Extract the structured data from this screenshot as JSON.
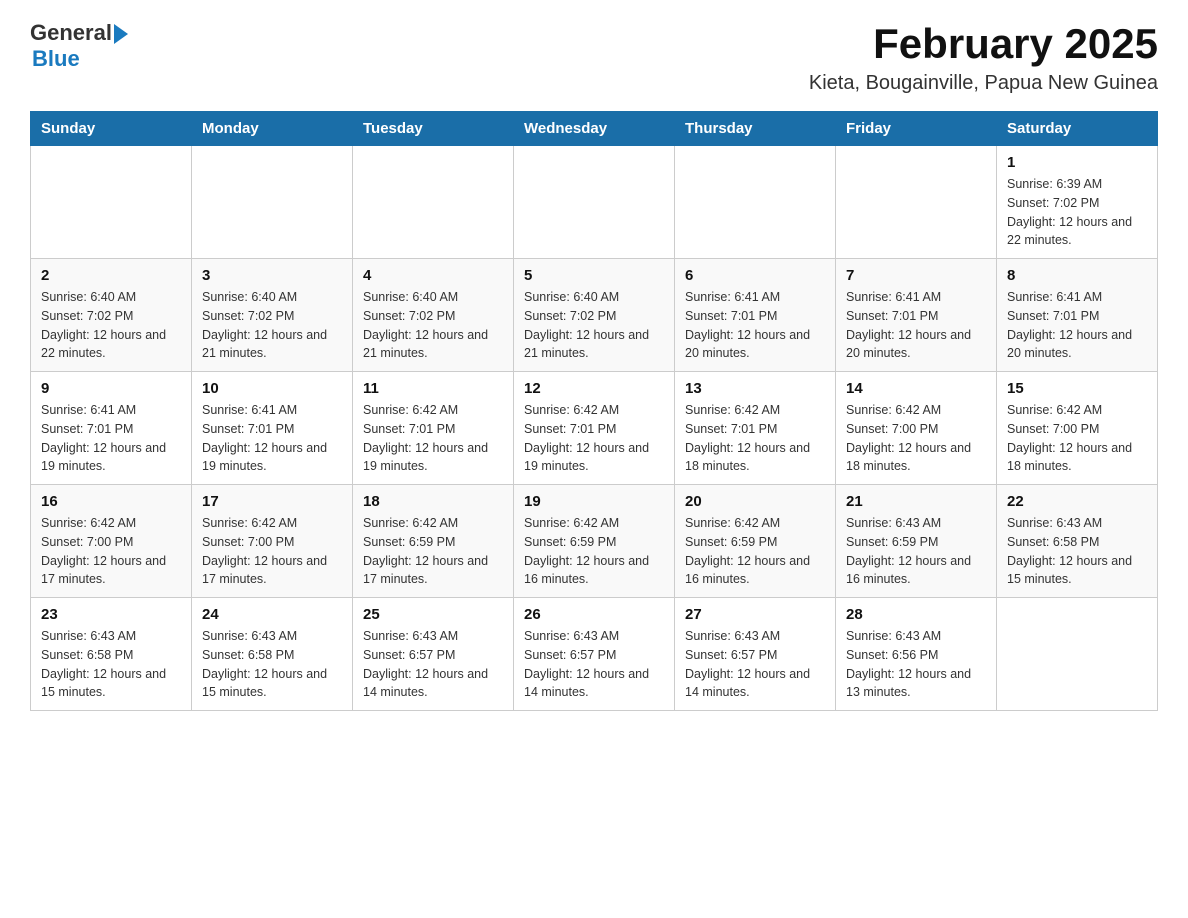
{
  "header": {
    "logo_text_general": "General",
    "logo_text_blue": "Blue",
    "title": "February 2025",
    "subtitle": "Kieta, Bougainville, Papua New Guinea"
  },
  "days_of_week": [
    "Sunday",
    "Monday",
    "Tuesday",
    "Wednesday",
    "Thursday",
    "Friday",
    "Saturday"
  ],
  "weeks": [
    [
      {
        "day": "",
        "info": ""
      },
      {
        "day": "",
        "info": ""
      },
      {
        "day": "",
        "info": ""
      },
      {
        "day": "",
        "info": ""
      },
      {
        "day": "",
        "info": ""
      },
      {
        "day": "",
        "info": ""
      },
      {
        "day": "1",
        "info": "Sunrise: 6:39 AM\nSunset: 7:02 PM\nDaylight: 12 hours and 22 minutes."
      }
    ],
    [
      {
        "day": "2",
        "info": "Sunrise: 6:40 AM\nSunset: 7:02 PM\nDaylight: 12 hours and 22 minutes."
      },
      {
        "day": "3",
        "info": "Sunrise: 6:40 AM\nSunset: 7:02 PM\nDaylight: 12 hours and 21 minutes."
      },
      {
        "day": "4",
        "info": "Sunrise: 6:40 AM\nSunset: 7:02 PM\nDaylight: 12 hours and 21 minutes."
      },
      {
        "day": "5",
        "info": "Sunrise: 6:40 AM\nSunset: 7:02 PM\nDaylight: 12 hours and 21 minutes."
      },
      {
        "day": "6",
        "info": "Sunrise: 6:41 AM\nSunset: 7:01 PM\nDaylight: 12 hours and 20 minutes."
      },
      {
        "day": "7",
        "info": "Sunrise: 6:41 AM\nSunset: 7:01 PM\nDaylight: 12 hours and 20 minutes."
      },
      {
        "day": "8",
        "info": "Sunrise: 6:41 AM\nSunset: 7:01 PM\nDaylight: 12 hours and 20 minutes."
      }
    ],
    [
      {
        "day": "9",
        "info": "Sunrise: 6:41 AM\nSunset: 7:01 PM\nDaylight: 12 hours and 19 minutes."
      },
      {
        "day": "10",
        "info": "Sunrise: 6:41 AM\nSunset: 7:01 PM\nDaylight: 12 hours and 19 minutes."
      },
      {
        "day": "11",
        "info": "Sunrise: 6:42 AM\nSunset: 7:01 PM\nDaylight: 12 hours and 19 minutes."
      },
      {
        "day": "12",
        "info": "Sunrise: 6:42 AM\nSunset: 7:01 PM\nDaylight: 12 hours and 19 minutes."
      },
      {
        "day": "13",
        "info": "Sunrise: 6:42 AM\nSunset: 7:01 PM\nDaylight: 12 hours and 18 minutes."
      },
      {
        "day": "14",
        "info": "Sunrise: 6:42 AM\nSunset: 7:00 PM\nDaylight: 12 hours and 18 minutes."
      },
      {
        "day": "15",
        "info": "Sunrise: 6:42 AM\nSunset: 7:00 PM\nDaylight: 12 hours and 18 minutes."
      }
    ],
    [
      {
        "day": "16",
        "info": "Sunrise: 6:42 AM\nSunset: 7:00 PM\nDaylight: 12 hours and 17 minutes."
      },
      {
        "day": "17",
        "info": "Sunrise: 6:42 AM\nSunset: 7:00 PM\nDaylight: 12 hours and 17 minutes."
      },
      {
        "day": "18",
        "info": "Sunrise: 6:42 AM\nSunset: 6:59 PM\nDaylight: 12 hours and 17 minutes."
      },
      {
        "day": "19",
        "info": "Sunrise: 6:42 AM\nSunset: 6:59 PM\nDaylight: 12 hours and 16 minutes."
      },
      {
        "day": "20",
        "info": "Sunrise: 6:42 AM\nSunset: 6:59 PM\nDaylight: 12 hours and 16 minutes."
      },
      {
        "day": "21",
        "info": "Sunrise: 6:43 AM\nSunset: 6:59 PM\nDaylight: 12 hours and 16 minutes."
      },
      {
        "day": "22",
        "info": "Sunrise: 6:43 AM\nSunset: 6:58 PM\nDaylight: 12 hours and 15 minutes."
      }
    ],
    [
      {
        "day": "23",
        "info": "Sunrise: 6:43 AM\nSunset: 6:58 PM\nDaylight: 12 hours and 15 minutes."
      },
      {
        "day": "24",
        "info": "Sunrise: 6:43 AM\nSunset: 6:58 PM\nDaylight: 12 hours and 15 minutes."
      },
      {
        "day": "25",
        "info": "Sunrise: 6:43 AM\nSunset: 6:57 PM\nDaylight: 12 hours and 14 minutes."
      },
      {
        "day": "26",
        "info": "Sunrise: 6:43 AM\nSunset: 6:57 PM\nDaylight: 12 hours and 14 minutes."
      },
      {
        "day": "27",
        "info": "Sunrise: 6:43 AM\nSunset: 6:57 PM\nDaylight: 12 hours and 14 minutes."
      },
      {
        "day": "28",
        "info": "Sunrise: 6:43 AM\nSunset: 6:56 PM\nDaylight: 12 hours and 13 minutes."
      },
      {
        "day": "",
        "info": ""
      }
    ]
  ]
}
